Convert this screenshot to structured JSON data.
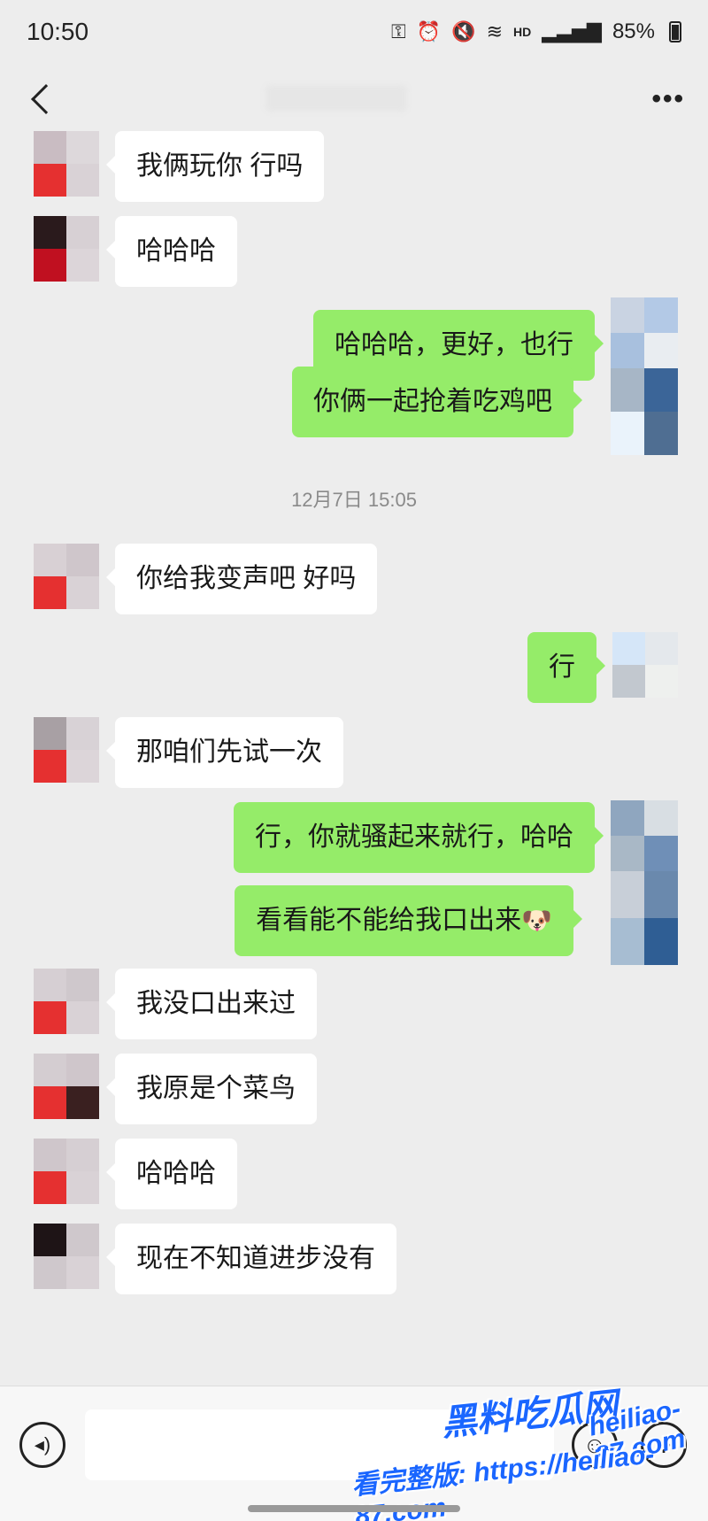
{
  "status_bar": {
    "time": "10:50",
    "icons": [
      "key-icon",
      "alarm-icon",
      "mute-icon",
      "wifi-icon",
      "hd-icon",
      "signal-icon"
    ],
    "hd": "HD",
    "battery": "85%"
  },
  "nav": {
    "title": "",
    "more": "•••"
  },
  "messages": [
    {
      "side": "in",
      "text": "我俩玩你 行吗"
    },
    {
      "side": "in",
      "text": "哈哈哈"
    },
    {
      "side": "out",
      "text": "哈哈哈，更好，也行"
    },
    {
      "side": "out",
      "text": "你俩一起抢着吃鸡吧"
    },
    {
      "side": "in",
      "text": "你给我变声吧 好吗"
    },
    {
      "side": "out",
      "text": "行"
    },
    {
      "side": "in",
      "text": "那咱们先试一次"
    },
    {
      "side": "out",
      "text": "行，你就骚起来就行，哈哈"
    },
    {
      "side": "out",
      "text": "看看能不能给我口出来",
      "emoji": "🐶"
    },
    {
      "side": "in",
      "text": "我没口出来过"
    },
    {
      "side": "in",
      "text": "我原是个菜鸟"
    },
    {
      "side": "in",
      "text": "哈哈哈"
    },
    {
      "side": "in",
      "text": "现在不知道进步没有"
    }
  ],
  "timestamp": "12月7日 15:05",
  "input_bar": {
    "placeholder": "",
    "voice_icon": "voice-icon",
    "emoji_icon": "emoji-icon",
    "plus_icon": "plus-icon"
  },
  "watermark": {
    "title": "黑料吃瓜网",
    "url": "heiliao-87.com",
    "note": "看完整版: https://heiliao-87.com"
  },
  "colors": {
    "background": "#ededed",
    "incoming_bubble": "#ffffff",
    "outgoing_bubble": "#95ec69",
    "watermark": "#1a66ff"
  }
}
